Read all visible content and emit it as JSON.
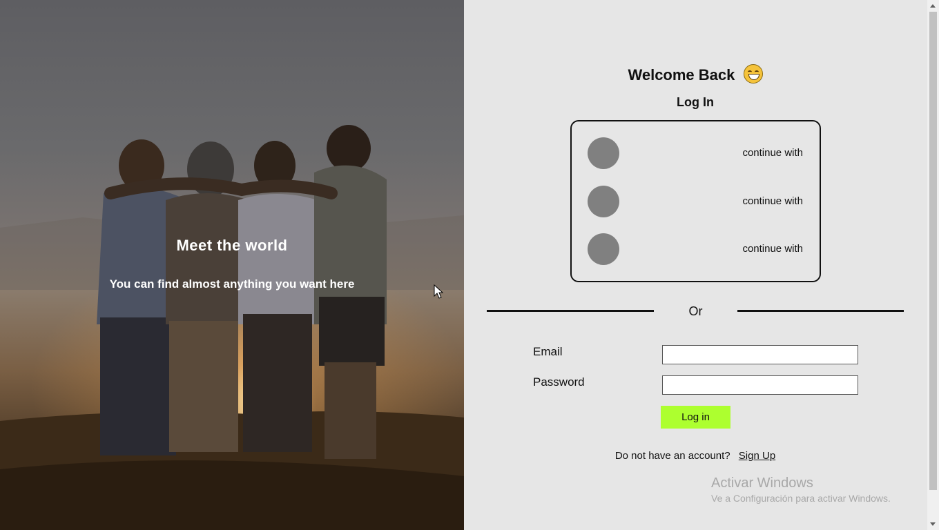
{
  "hero": {
    "title": "Meet the world",
    "subtitle": "You can find almost anything you want here"
  },
  "login": {
    "welcome": "Welcome Back",
    "welcome_emoji": "grinning-face-icon",
    "heading": "Log In",
    "social": [
      {
        "label": "continue with"
      },
      {
        "label": "continue with"
      },
      {
        "label": "continue with"
      }
    ],
    "divider_text": "Or",
    "email_label": "Email",
    "email_value": "",
    "password_label": "Password",
    "password_value": "",
    "submit_label": "Log in",
    "signup_prompt": "Do not have an account?",
    "signup_link": "Sign Up"
  },
  "watermark": {
    "title": "Activar Windows",
    "subtitle": "Ve a Configuración para activar Windows."
  },
  "colors": {
    "accent_button": "#adff2f",
    "background": "#e6e6e6",
    "social_icon": "#808080"
  }
}
